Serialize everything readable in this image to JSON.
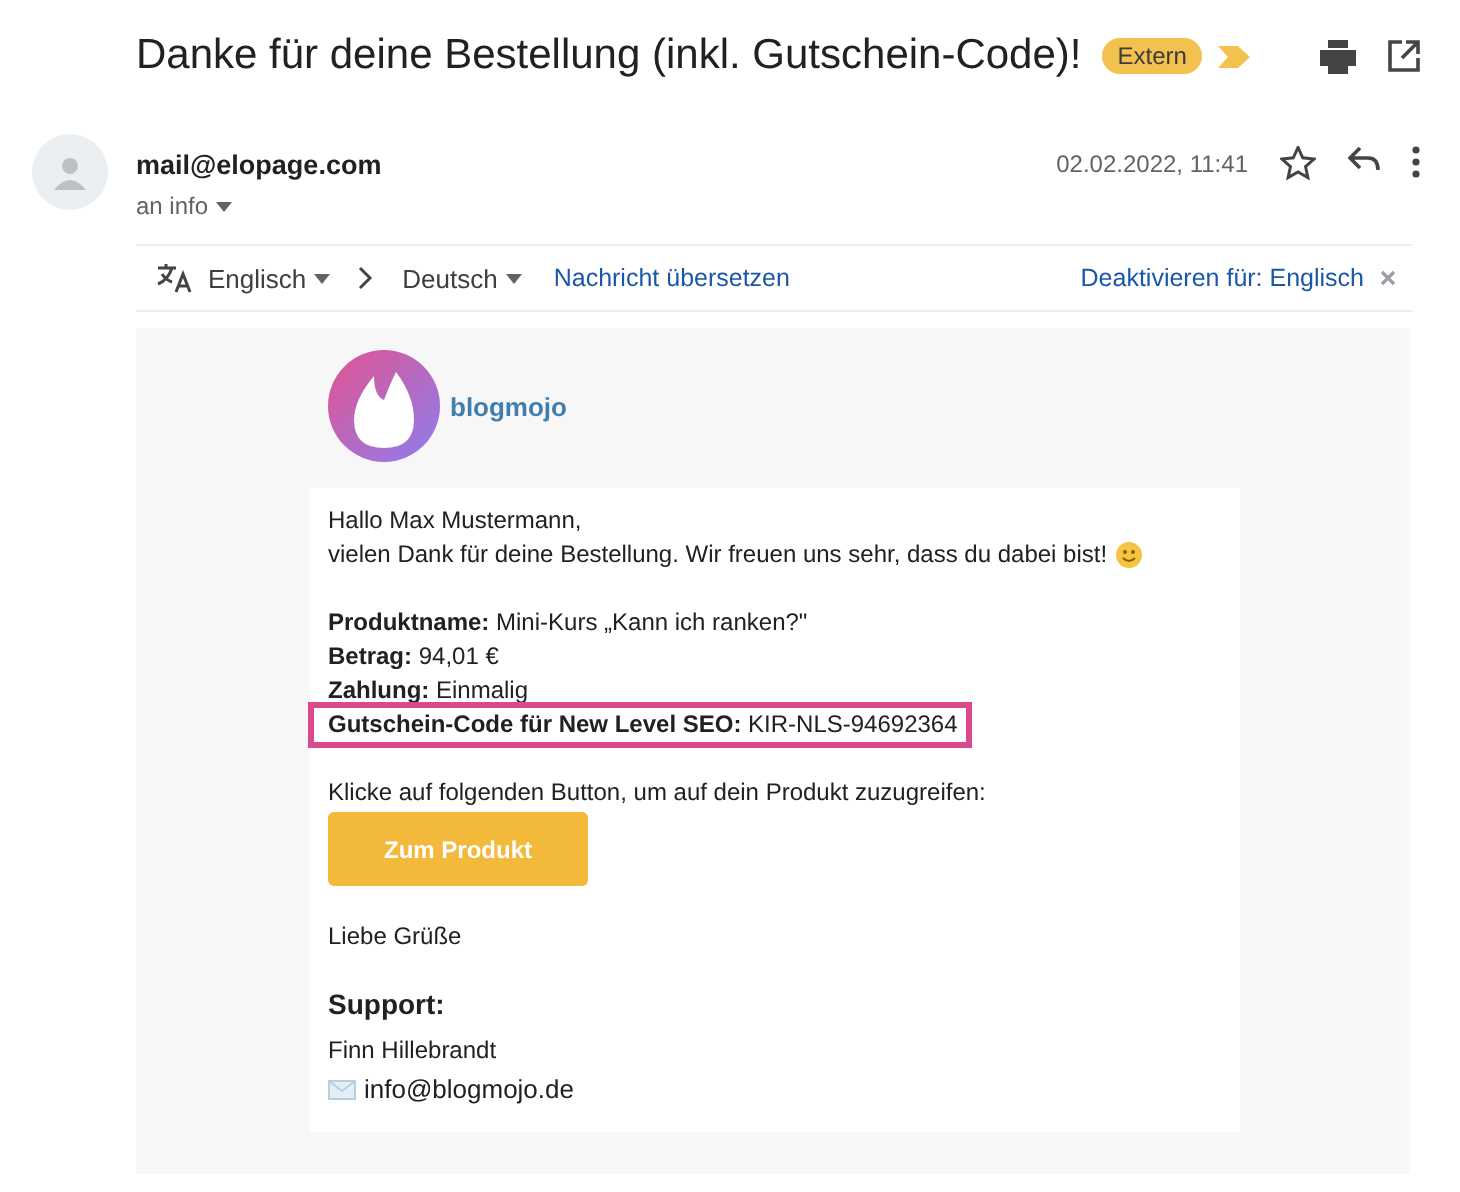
{
  "subject": "Danke für deine Bestellung (inkl. Gutschein-Code)!",
  "label": "Extern",
  "important": true,
  "sender": {
    "address": "mail@elopage.com",
    "recipient": "an info",
    "date": "02.02.2022, 11:41"
  },
  "translate": {
    "from": "Englisch",
    "to": "Deutsch",
    "action": "Nachricht übersetzen",
    "disable": "Deaktivieren für: Englisch"
  },
  "brand": "blogmojo",
  "paragraphs": [
    {
      "lines": [
        {
          "kind": "text",
          "text": "Hallo Max Mustermann,"
        },
        {
          "kind": "text",
          "text": "vielen Dank für deine Bestellung. Wir freuen uns sehr, dass du dabei bist!",
          "emoji": true
        }
      ]
    },
    {
      "lines": [
        {
          "kind": "text",
          "text": "**Produktname:** Mini-Kurs „Kann ich ranken?\""
        },
        {
          "kind": "text",
          "text": "**Betrag:** 94,01 €"
        },
        {
          "kind": "text",
          "text": "**Zahlung:** Einmalig"
        },
        {
          "kind": "text",
          "text": "**Gutschein-Code für New Level SEO:** KIR-NLS-94692364",
          "highlighted": true
        }
      ]
    },
    {
      "lines": [
        {
          "kind": "text",
          "text": "Klicke auf folgenden Button, um auf dein Produkt zuzugreifen:"
        },
        {
          "kind": "button",
          "text": "Zum Produkt"
        }
      ]
    },
    {
      "lines": [
        {
          "kind": "text",
          "text": "Liebe Grüße"
        }
      ]
    },
    {
      "lines": [
        {
          "kind": "heading",
          "text": "Support:"
        },
        {
          "kind": "text",
          "text": "Finn Hillebrandt"
        },
        {
          "kind": "email",
          "text": "info@blogmojo.de"
        }
      ]
    }
  ]
}
